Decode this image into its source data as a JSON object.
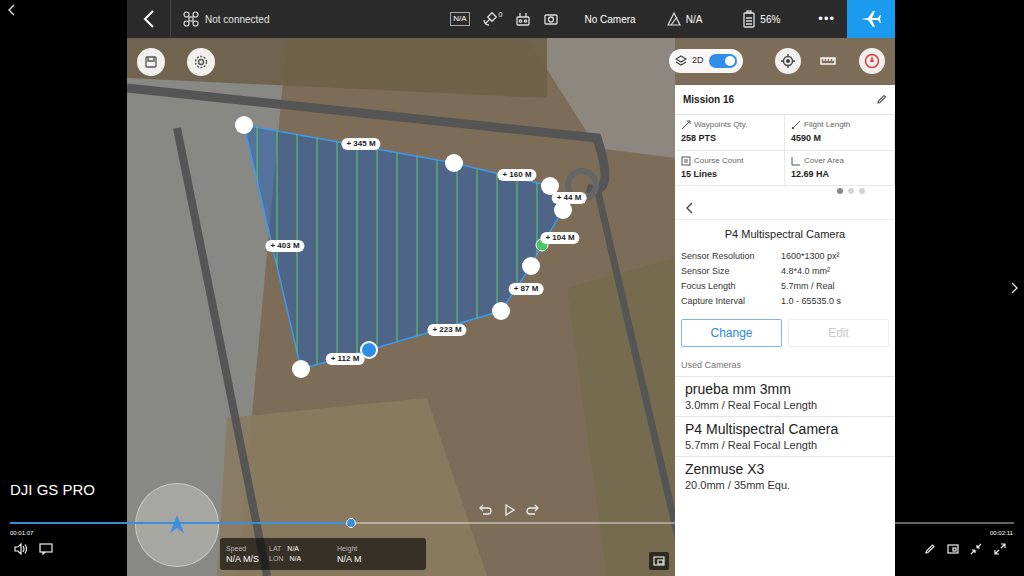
{
  "player": {
    "title": "DJI GS PRO",
    "elapsed": "00:01:07",
    "duration": "00:02:11",
    "level": 0.34
  },
  "topbar": {
    "connection": "Not connected",
    "rc_status": "N/A",
    "satellites": "0",
    "camera": "No Camera",
    "signal": "N/A",
    "battery": "56%",
    "more": "•••"
  },
  "map": {
    "view_toggle": {
      "label": "2D",
      "on": true
    },
    "edges": [
      "+ 345 M",
      "+ 160 M",
      "+ 44 M",
      "+ 104 M",
      "+ 87 M",
      "+ 223 M",
      "+ 112 M",
      "+ 403 M"
    ],
    "vertices": [
      {
        "kind": "corner",
        "selected": false
      },
      {
        "kind": "corner",
        "selected": false
      },
      {
        "kind": "corner",
        "selected": false
      },
      {
        "kind": "corner",
        "selected": false
      },
      {
        "kind": "start",
        "selected": false
      },
      {
        "kind": "corner",
        "selected": false
      },
      {
        "kind": "corner",
        "selected": false
      },
      {
        "kind": "corner",
        "selected": true
      },
      {
        "kind": "corner",
        "selected": false
      }
    ]
  },
  "mission": {
    "title": "Mission 16",
    "stats": [
      {
        "label": "Waypoints Qty.",
        "value": "258 PTS"
      },
      {
        "label": "Flight Length",
        "value": "4590 M"
      },
      {
        "label": "Course Count",
        "value": "15 Lines"
      },
      {
        "label": "Cover Area",
        "value": "12.69 HA"
      }
    ],
    "pages": [
      {
        "selected": true
      },
      {
        "selected": false
      },
      {
        "selected": false
      }
    ]
  },
  "camera": {
    "title": "P4 Multispectral Camera",
    "specs": [
      {
        "label": "Sensor Resolution",
        "value": "1600*1300 px²"
      },
      {
        "label": "Sensor Size",
        "value": "4.8*4.0 mm²"
      },
      {
        "label": "Focus Length",
        "value": "5.7mm / Real"
      },
      {
        "label": "Capture Interval",
        "value": "1.0 - 65535.0 s"
      }
    ],
    "buttons": [
      {
        "label": "Change",
        "disabled": false
      },
      {
        "label": "Edit",
        "disabled": true
      }
    ]
  },
  "used_cameras": {
    "title": "Used Cameras",
    "items": [
      {
        "name": "prueba mm 3mm",
        "detail": "3.0mm / Real Focal Length"
      },
      {
        "name": "P4 Multispectral Camera",
        "detail": "5.7mm / Real Focal Length"
      },
      {
        "name": "Zenmuse X3",
        "detail": "20.0mm / 35mm Equ."
      }
    ]
  },
  "telemetry": {
    "speed_label": "Speed",
    "speed": "N/A M/S",
    "lat_label": "LAT",
    "lat": "N/A",
    "lon_label": "LON",
    "lon": "N/A",
    "height_label": "Height",
    "height": "N/A M"
  }
}
